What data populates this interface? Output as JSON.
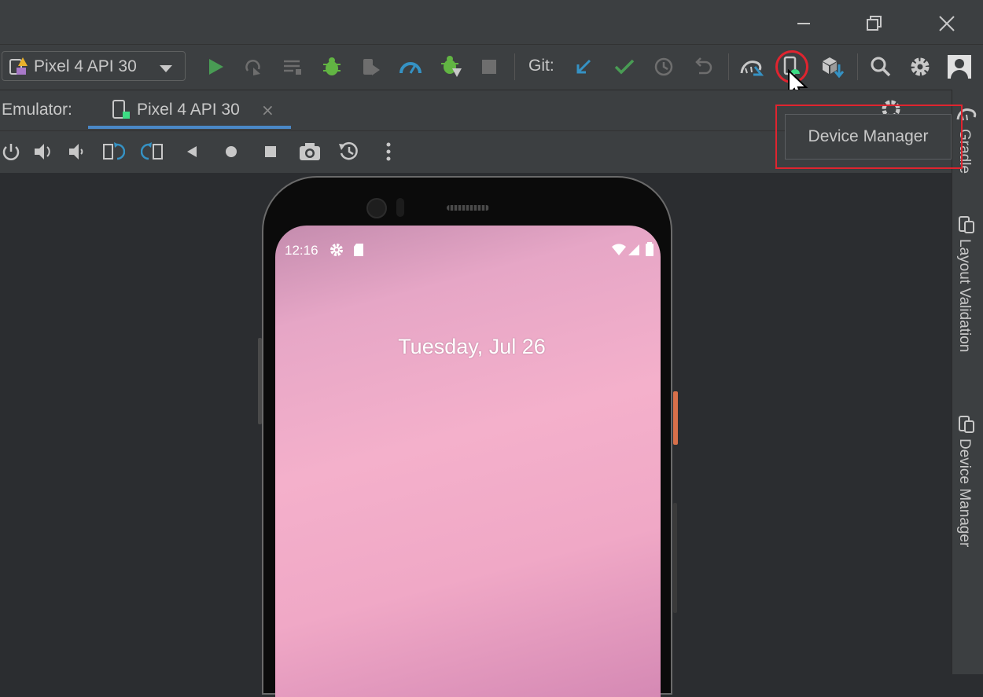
{
  "window": {
    "controls": [
      "minimize-icon",
      "restore-icon",
      "close-icon"
    ]
  },
  "toolbar": {
    "run_config": "Pixel 4 API 30",
    "git_label": "Git:",
    "icons": [
      "run-icon",
      "apply-changes-icon",
      "apply-code-changes-icon",
      "debug-icon",
      "attach-debugger-icon",
      "profile-icon",
      "debug-attach-icon",
      "stop-icon",
      "git-update-icon",
      "git-commit-icon",
      "git-history-icon",
      "git-rollback-icon",
      "sync-gradle-icon",
      "device-manager-icon",
      "sdk-manager-icon",
      "search-icon",
      "settings-icon",
      "account-icon"
    ],
    "colors": {
      "run": "#499c54",
      "debug": "#62b543",
      "blue": "#3592c4",
      "device_green": "#3ddc84"
    }
  },
  "emulator": {
    "label": "Emulator:",
    "tab_label": "Pixel 4 API 30",
    "tab_close": "×",
    "controls": [
      "power-icon",
      "volume-up-icon",
      "volume-down-icon",
      "rotate-left-icon",
      "rotate-right-icon",
      "back-icon",
      "home-icon",
      "overview-icon",
      "screenshot-icon",
      "snapshot-icon",
      "more-icon"
    ]
  },
  "phone": {
    "time": "12:16",
    "date": "Tuesday, Jul 26"
  },
  "tooltip": {
    "text": "Device Manager"
  },
  "right_strip": {
    "gradle": "Gradle",
    "layout_validation": "Layout Validation",
    "device_manager": "Device Manager"
  },
  "accent_colors": {
    "highlight": "#e0242f",
    "tab_underline": "#4a88c7"
  }
}
